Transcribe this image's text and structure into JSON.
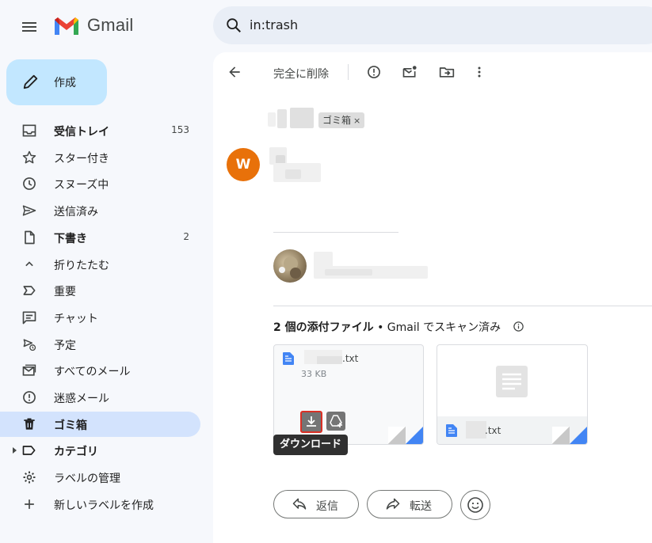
{
  "app": {
    "name": "Gmail",
    "accent": "#c2e7ff"
  },
  "search": {
    "query": "in:trash"
  },
  "compose": {
    "label": "作成"
  },
  "sidebar": {
    "items": [
      {
        "label": "受信トレイ",
        "count": "153",
        "bold": true,
        "icon": "inbox-icon"
      },
      {
        "label": "スター付き",
        "count": "",
        "icon": "star-icon"
      },
      {
        "label": "スヌーズ中",
        "count": "",
        "icon": "clock-icon"
      },
      {
        "label": "送信済み",
        "count": "",
        "icon": "send-icon"
      },
      {
        "label": "下書き",
        "count": "2",
        "bold": true,
        "icon": "draft-icon"
      },
      {
        "label": "折りたたむ",
        "count": "",
        "icon": "chevron-up-icon"
      },
      {
        "label": "重要",
        "count": "",
        "icon": "important-icon"
      },
      {
        "label": "チャット",
        "count": "",
        "icon": "chat-icon"
      },
      {
        "label": "予定",
        "count": "",
        "icon": "scheduled-icon"
      },
      {
        "label": "すべてのメール",
        "count": "",
        "icon": "all-mail-icon"
      },
      {
        "label": "迷惑メール",
        "count": "",
        "icon": "spam-icon"
      },
      {
        "label": "ゴミ箱",
        "count": "",
        "bold": true,
        "active": true,
        "icon": "trash-icon"
      },
      {
        "label": "カテゴリ",
        "count": "",
        "bold": true,
        "icon": "label-icon"
      },
      {
        "label": "ラベルの管理",
        "count": "",
        "icon": "gear-icon"
      },
      {
        "label": "新しいラベルを作成",
        "count": "",
        "icon": "plus-icon"
      }
    ]
  },
  "toolbar": {
    "delete_forever_label": "完全に削除"
  },
  "message": {
    "label_chip": "ゴミ箱",
    "label_chip_close": "×",
    "sender_initial": "W",
    "attachments_heading_bold": "2 個の添付ファイル",
    "attachments_heading_rest": " • Gmail でスキャン済み",
    "attachments": [
      {
        "name_suffix": ".txt",
        "size": "33 KB"
      },
      {
        "name_suffix": ".txt"
      }
    ],
    "download_tooltip": "ダウンロード"
  },
  "actions": {
    "reply_label": "返信",
    "forward_label": "転送"
  }
}
